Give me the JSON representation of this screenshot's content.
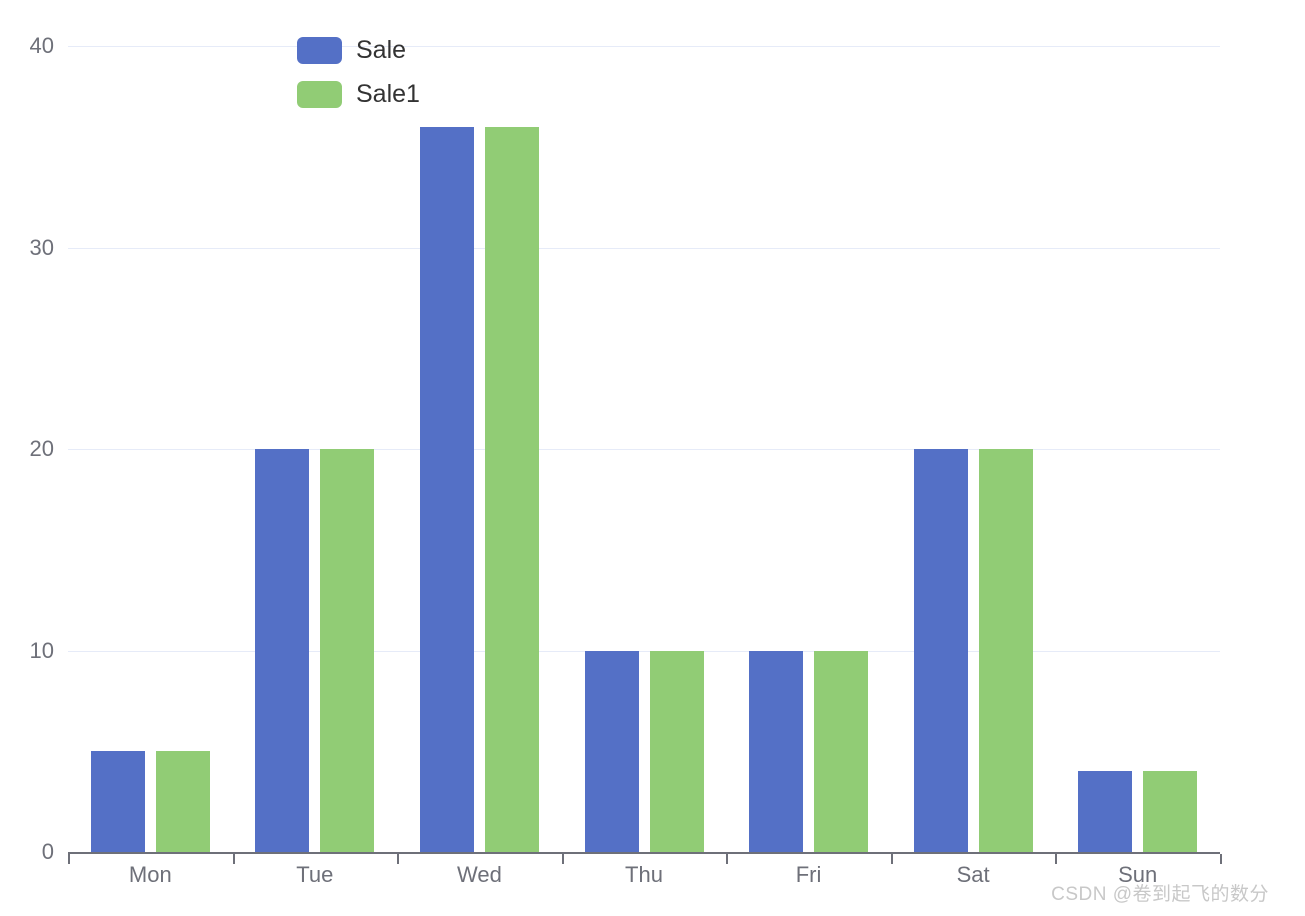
{
  "chart_data": {
    "type": "bar",
    "title": "",
    "subtitle": "",
    "xlabel": "",
    "ylabel": "",
    "categories": [
      "Mon",
      "Tue",
      "Wed",
      "Thu",
      "Fri",
      "Sat",
      "Sun"
    ],
    "series": [
      {
        "name": "Sale",
        "color": "#5470c6",
        "values": [
          5,
          20,
          36,
          10,
          10,
          20,
          4
        ]
      },
      {
        "name": "Sale1",
        "color": "#91cc75",
        "values": [
          5,
          20,
          36,
          10,
          10,
          20,
          4
        ]
      }
    ],
    "ylim": [
      0,
      40
    ],
    "yticks": [
      0,
      10,
      20,
      30,
      40
    ],
    "ytick_labels": [
      "0",
      "10",
      "20",
      "30",
      "40"
    ],
    "grid": true,
    "grid_axis": "y",
    "legend_position": "top-left",
    "axis_label_color": "#6e7079",
    "gridline_color": "#e6ebf8",
    "axis_line_color": "#6e7079",
    "background": "#ffffff"
  },
  "watermark": {
    "text": "CSDN @卷到起飞的数分"
  }
}
